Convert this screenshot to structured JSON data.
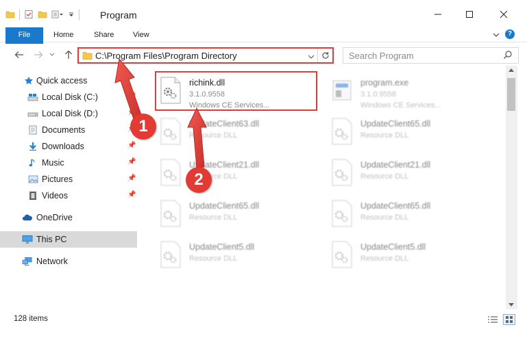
{
  "window": {
    "title": "Program"
  },
  "ribbon": {
    "tabs": [
      "File",
      "Home",
      "Share",
      "View"
    ],
    "help": "?"
  },
  "address": {
    "path": "C:\\Program Files\\Program Directory"
  },
  "search": {
    "placeholder": "Search Program"
  },
  "sidebar": {
    "items": [
      {
        "label": "Quick access",
        "icon": "star-icon"
      },
      {
        "label": "Local Disk (C:)",
        "icon": "drive-icon",
        "pinned": true
      },
      {
        "label": "Local Disk (D:)",
        "icon": "drive-icon",
        "pinned": true
      },
      {
        "label": "Documents",
        "icon": "documents-icon",
        "pinned": true
      },
      {
        "label": "Downloads",
        "icon": "downloads-icon",
        "pinned": true
      },
      {
        "label": "Music",
        "icon": "music-icon",
        "pinned": true
      },
      {
        "label": "Pictures",
        "icon": "pictures-icon",
        "pinned": true
      },
      {
        "label": "Videos",
        "icon": "videos-icon",
        "pinned": true
      },
      {
        "label": "OneDrive",
        "icon": "cloud-icon"
      },
      {
        "label": "This PC",
        "icon": "computer-icon",
        "selected": true
      },
      {
        "label": "Network",
        "icon": "network-icon"
      }
    ]
  },
  "files": [
    {
      "name": "richink.dll",
      "type": "3.1.0.9558",
      "desc": "Windows CE Services...",
      "highlighted": true
    },
    {
      "name": "program.exe",
      "type": "3.1.0.9558",
      "desc": "Windows CE Services..."
    },
    {
      "name": "UpdateClient63.dll",
      "type": "Resource DLL"
    },
    {
      "name": "UpdateClient65.dll",
      "type": "Resource DLL"
    },
    {
      "name": "UpdateClient21.dll",
      "type": "Resource DLL"
    },
    {
      "name": "UpdateClient21.dll",
      "type": "Resource DLL"
    },
    {
      "name": "UpdateClient65.dll",
      "type": "Resource DLL"
    },
    {
      "name": "UpdateClient65.dll",
      "type": "Resource DLL"
    },
    {
      "name": "UpdateClient5.dll",
      "type": "Resource DLL"
    },
    {
      "name": "UpdateClient5.dll",
      "type": "Resource DLL"
    }
  ],
  "status": {
    "count": "128 items"
  },
  "callouts": [
    "1",
    "2"
  ],
  "colors": {
    "accent": "#1979ca",
    "highlight": "#e43a3a",
    "callout": "#e23b36",
    "selected": "#d9d9d9"
  }
}
